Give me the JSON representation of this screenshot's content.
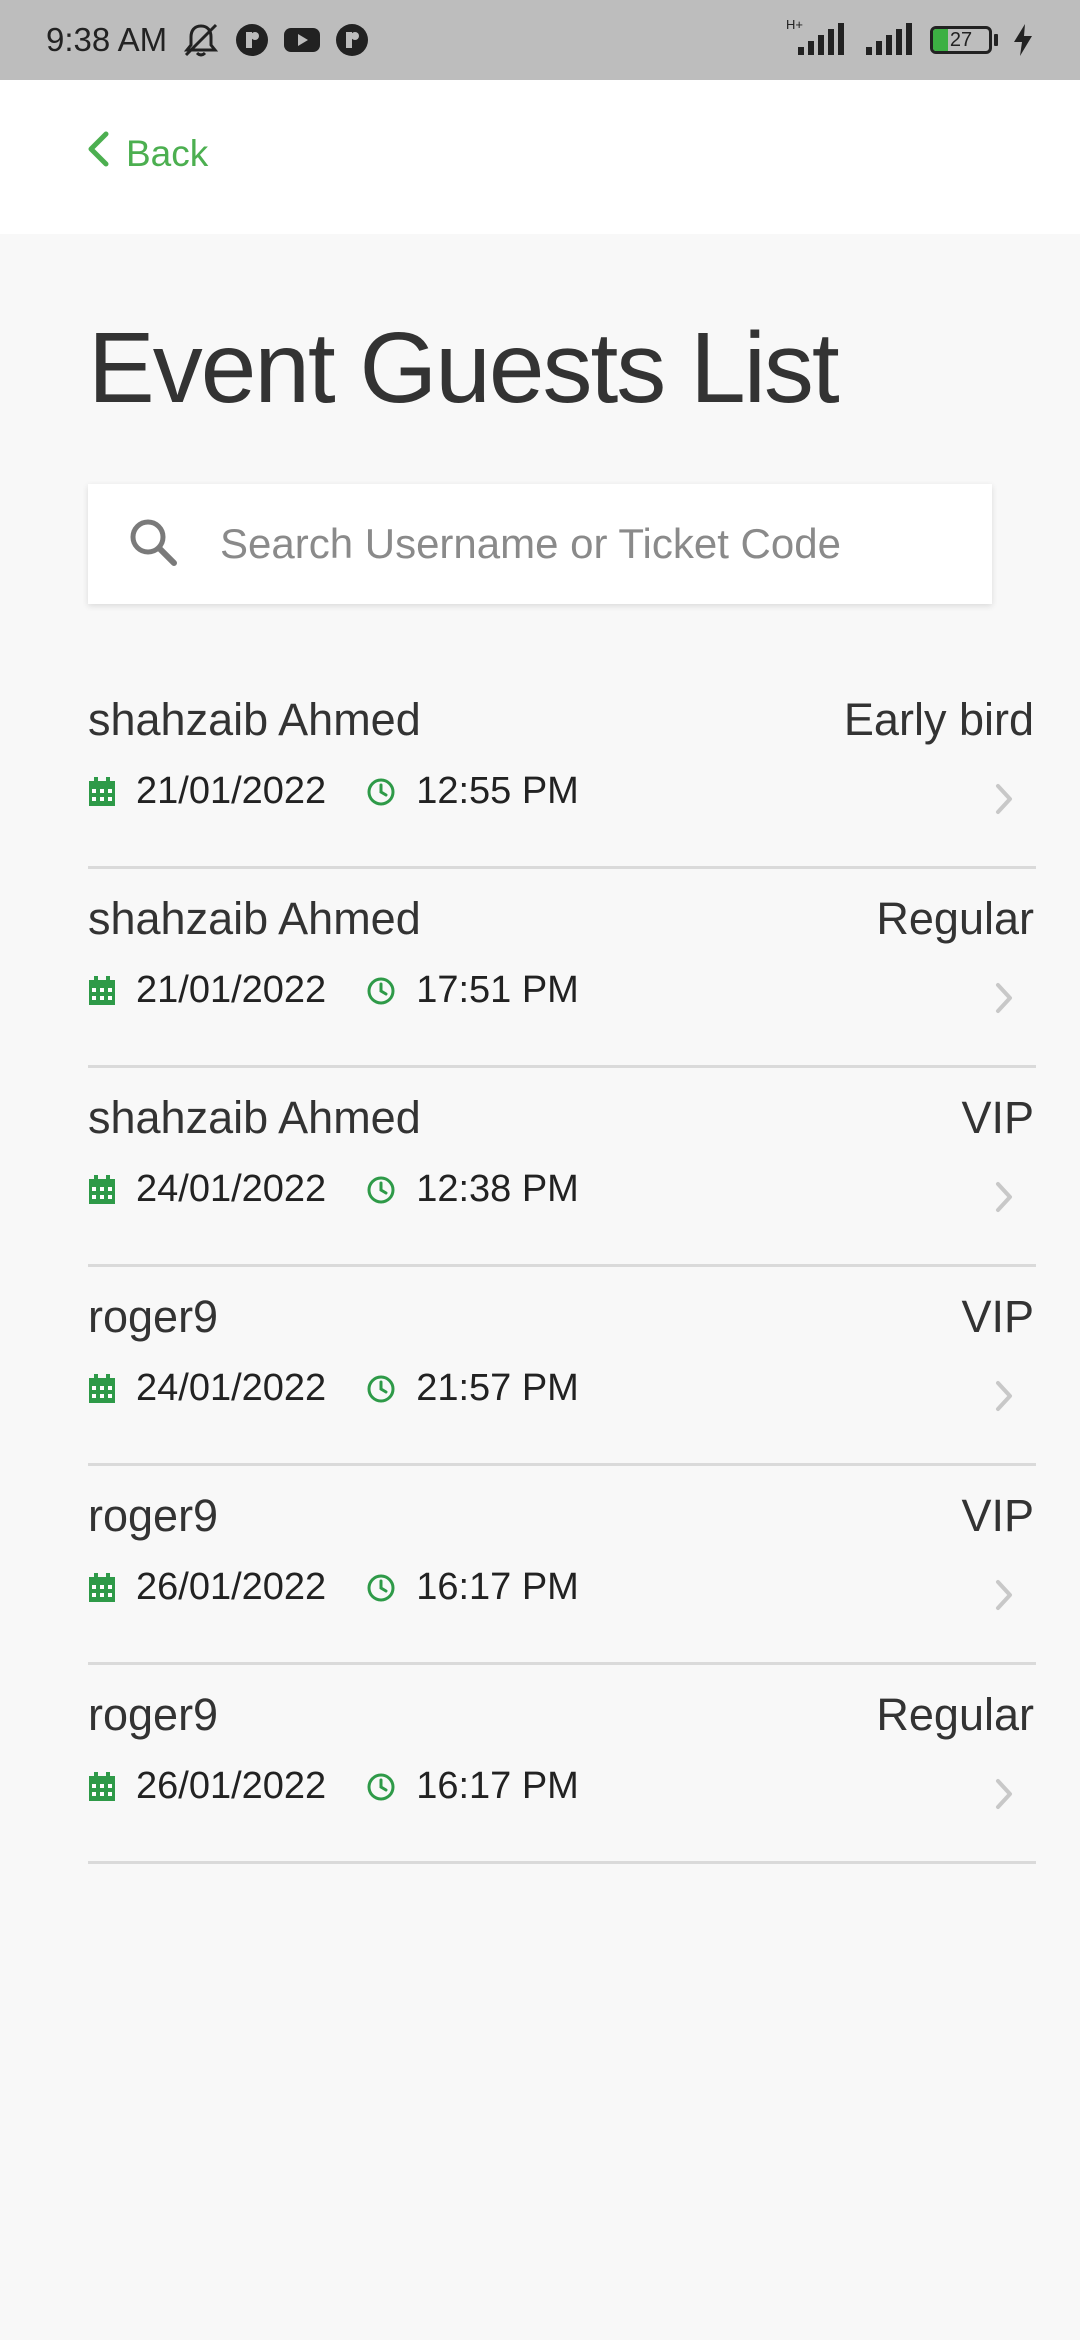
{
  "status_bar": {
    "time": "9:38 AM",
    "network": "H+",
    "battery_level": "27",
    "battery_fraction": 0.27,
    "battery_color": "#3cb043"
  },
  "header": {
    "back_label": "Back",
    "accent_color": "#4caf50"
  },
  "page": {
    "title": "Event Guests List"
  },
  "search": {
    "placeholder": "Search Username or Ticket Code",
    "value": ""
  },
  "guests": [
    {
      "name": "shahzaib Ahmed",
      "ticket_type": "Early bird",
      "date": "21/01/2022",
      "time": "12:55 PM"
    },
    {
      "name": "shahzaib Ahmed",
      "ticket_type": "Regular",
      "date": "21/01/2022",
      "time": "17:51 PM"
    },
    {
      "name": "shahzaib Ahmed",
      "ticket_type": "VIP",
      "date": "24/01/2022",
      "time": "12:38 PM"
    },
    {
      "name": "roger9",
      "ticket_type": "VIP",
      "date": "24/01/2022",
      "time": "21:57 PM"
    },
    {
      "name": "roger9",
      "ticket_type": "VIP",
      "date": "26/01/2022",
      "time": "16:17 PM"
    },
    {
      "name": "roger9",
      "ticket_type": "Regular",
      "date": "26/01/2022",
      "time": "16:17 PM"
    }
  ],
  "icons": {
    "date": "calendar-icon",
    "time": "clock-icon",
    "row_action": "chevron-right-icon",
    "search": "search-icon",
    "back": "chevron-left-icon"
  }
}
